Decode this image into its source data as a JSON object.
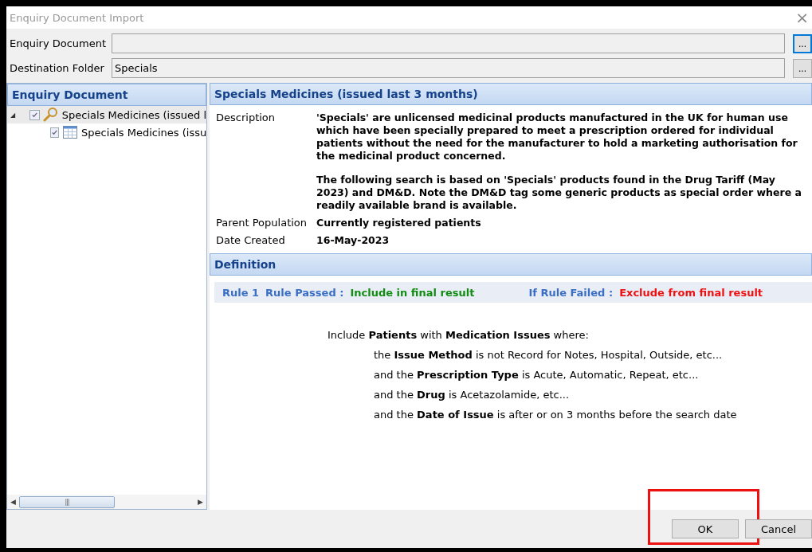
{
  "window": {
    "title": "Enquiry Document Import",
    "close": "×"
  },
  "fields": [
    {
      "label": "Enquiry Document",
      "browse": "...",
      "focused": true
    },
    {
      "label": "Destination Folder",
      "value": "Specials",
      "browse": "...",
      "focused": false
    }
  ],
  "tree": {
    "header": "Enquiry Document",
    "items": [
      {
        "label": "Specials Medicines (issued l",
        "kind": "query",
        "checked": true,
        "selected": true,
        "expanded": true,
        "toggle": "◢",
        "children": [
          {
            "label": "Specials Medicines (issu",
            "kind": "report",
            "checked": true,
            "selected": false
          }
        ]
      }
    ],
    "scroll": {
      "left": "◀",
      "right": "▶",
      "grip": "|||"
    }
  },
  "detail": {
    "header": "Specials Medicines (issued last 3 months)",
    "properties": [
      {
        "label": "Description",
        "paragraphs": [
          "'Specials' are unlicensed medicinal products manufactured in the UK for human use which have been specially prepared to meet a prescription ordered for individual patients without the need for the manufacturer to hold a marketing authorisation for the medicinal product concerned.",
          "The following search is based on 'Specials' products found in the Drug Tariff (May 2023) and DM&D. Note the DM&D tag some generic products as special order where a readily available brand is available."
        ]
      },
      {
        "label": "Parent Population",
        "paragraphs": [
          "Currently registered patients"
        ]
      },
      {
        "label": "Date Created",
        "paragraphs": [
          "16-May-2023"
        ]
      }
    ],
    "definition": "Definition",
    "rule": {
      "name": "Rule 1",
      "passed_label": "Rule Passed :",
      "passed_action": "Include in final result",
      "failed_label": "If Rule Failed :",
      "failed_action": "Exclude from final result"
    },
    "criteria": [
      {
        "text": "Include **Patients** with **Medication Issues** where:",
        "nested": false
      },
      {
        "text": "the **Issue Method** is not Record for Notes, Hospital, Outside, etc...",
        "nested": true
      },
      {
        "text": "and the **Prescription Type** is Acute, Automatic, Repeat, etc...",
        "nested": true
      },
      {
        "text": "and the **Drug** is Acetazolamide, etc...",
        "nested": true
      },
      {
        "text": "and the **Date of Issue** is after or on 3 months before the search date",
        "nested": true
      }
    ]
  },
  "buttons": [
    {
      "label": "OK",
      "highlighted": true
    },
    {
      "label": "Cancel",
      "highlighted": false
    }
  ]
}
